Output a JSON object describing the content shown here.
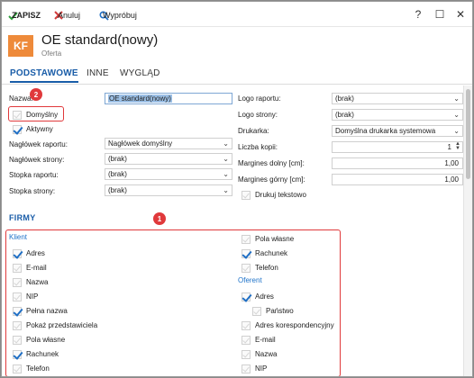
{
  "toolbar": {
    "save_label": "ZAPISZ",
    "cancel_label": "Anuluj",
    "test_label": "Wypróbuj"
  },
  "window_controls": {
    "help": "?",
    "maximize": "☐",
    "close": "✕"
  },
  "record": {
    "badge": "KF",
    "title": "OE standard(nowy)",
    "subtitle": "Oferta"
  },
  "tabs": [
    "PODSTAWOWE",
    "INNE",
    "WYGLĄD"
  ],
  "basic": {
    "name_label": "Nazwa:",
    "name_value": "OE standard(nowy)",
    "default_label": "Domyślny",
    "default_checked": false,
    "active_label": "Aktywny",
    "active_checked": true,
    "report_header_label": "Nagłówek raportu:",
    "report_header_value": "Nagłówek domyślny",
    "page_header_label": "Nagłówek strony:",
    "page_header_value": "(brak)",
    "report_footer_label": "Stopka raportu:",
    "report_footer_value": "(brak)",
    "page_footer_label": "Stopka strony:",
    "page_footer_value": "(brak)",
    "report_logo_label": "Logo raportu:",
    "report_logo_value": "(brak)",
    "page_logo_label": "Logo strony:",
    "page_logo_value": "(brak)",
    "printer_label": "Drukarka:",
    "printer_value": "Domyślna drukarka systemowa",
    "copies_label": "Liczba kopii:",
    "copies_value": "1",
    "margin_bottom_label": "Margines dolny [cm]:",
    "margin_bottom_value": "1,00",
    "margin_top_label": "Margines górny [cm]:",
    "margin_top_value": "1,00",
    "text_print_label": "Drukuj tekstowo",
    "text_print_checked": false
  },
  "firms": {
    "title": "FIRMY",
    "client_title": "Klient",
    "client_items": [
      {
        "label": "Adres",
        "checked": true
      },
      {
        "label": "E-mail",
        "checked": false
      },
      {
        "label": "Nazwa",
        "checked": false
      },
      {
        "label": "NIP",
        "checked": false
      },
      {
        "label": "Pełna nazwa",
        "checked": true
      },
      {
        "label": "Pokaż przedstawiciela",
        "checked": false
      },
      {
        "label": "Pola własne",
        "checked": false
      },
      {
        "label": "Rachunek",
        "checked": true
      },
      {
        "label": "Telefon",
        "checked": false
      }
    ],
    "client_extra_items": [
      {
        "label": "Pola własne",
        "checked": false
      },
      {
        "label": "Rachunek",
        "checked": true
      },
      {
        "label": "Telefon",
        "checked": false
      }
    ],
    "offerer_title": "Oferent",
    "offerer_items": [
      {
        "label": "Adres",
        "checked": true,
        "indent": false
      },
      {
        "label": "Państwo",
        "checked": false,
        "indent": true
      },
      {
        "label": "Adres korespondencyjny",
        "checked": false,
        "indent": false
      },
      {
        "label": "E-mail",
        "checked": false,
        "indent": false
      },
      {
        "label": "Nazwa",
        "checked": false,
        "indent": false
      },
      {
        "label": "NIP",
        "checked": false,
        "indent": false
      }
    ]
  },
  "annotations": {
    "marker_1": "1",
    "marker_2": "2",
    "highlight_color": "#e0393b"
  },
  "colors": {
    "accent": "#1a5da8",
    "badge": "#ee8a3a",
    "check": "#1f6fc5"
  },
  "icons": {
    "save": "check-icon",
    "cancel": "x-icon",
    "test": "search-icon"
  }
}
